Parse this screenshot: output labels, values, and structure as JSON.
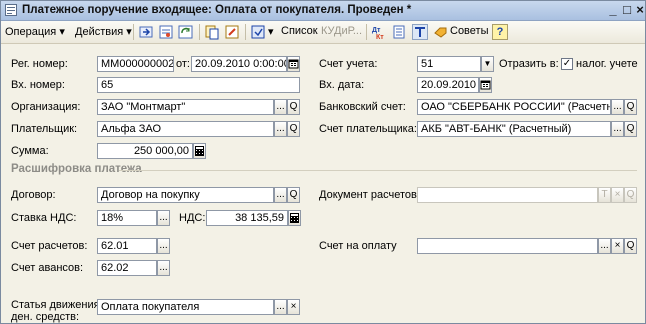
{
  "window": {
    "title": "Платежное поручение входящее: Оплата от покупателя. Проведен *"
  },
  "toolbar": {
    "operation_label": "Операция",
    "actions_label": "Действия",
    "list_label": "Список",
    "kudir_label": "КУДиР...",
    "advice_label": "Советы"
  },
  "form": {
    "reg_number": {
      "label": "Рег. номер:",
      "value": "ММ000000002",
      "from_label": "от:",
      "date": "20.09.2010  0:00:00"
    },
    "in_number": {
      "label": "Вх. номер:",
      "value": "65"
    },
    "organization": {
      "label": "Организация:",
      "value": "ЗАО \"Монтмарт\""
    },
    "payer": {
      "label": "Плательщик:",
      "value": "Альфа ЗАО"
    },
    "amount": {
      "label": "Сумма:",
      "value": "250 000,00"
    },
    "account": {
      "label": "Счет учета:",
      "value": "51"
    },
    "reflect": {
      "label": "Отразить в:",
      "checkbox_label": "налог. учете",
      "checked": true
    },
    "in_date": {
      "label": "Вх. дата:",
      "value": "20.09.2010"
    },
    "bank_account": {
      "label": "Банковский счет:",
      "value": "ОАО \"СБЕРБАНК РОССИИ\" (Расчетный)"
    },
    "payer_account": {
      "label": "Счет плательщика:",
      "value": "АКБ \"АВТ-БАНК\" (Расчетный)"
    }
  },
  "breakdown": {
    "section_title": "Расшифровка платежа",
    "contract": {
      "label": "Договор:",
      "value": "Договор на покупку"
    },
    "settlement_doc": {
      "label": "Документ расчетов:",
      "value": ""
    },
    "vat_rate": {
      "label": "Ставка НДС:",
      "value": "18%"
    },
    "vat": {
      "label": "НДС:",
      "value": "38 135,59"
    },
    "settlement_account": {
      "label": "Счет расчетов:",
      "value": "62.01"
    },
    "invoice_account": {
      "label": "Счет на оплату",
      "value": ""
    },
    "advance_account": {
      "label": "Счет авансов:",
      "value": "62.02"
    },
    "cash_flow_item": {
      "label_line1": "Статья движения",
      "label_line2": "ден. средств:",
      "value": "Оплата покупателя"
    }
  },
  "glyphs": {
    "ellipsis": "...",
    "search": "Q",
    "clear": "×",
    "dropdown": "▼",
    "check": "✓",
    "text": "T"
  }
}
